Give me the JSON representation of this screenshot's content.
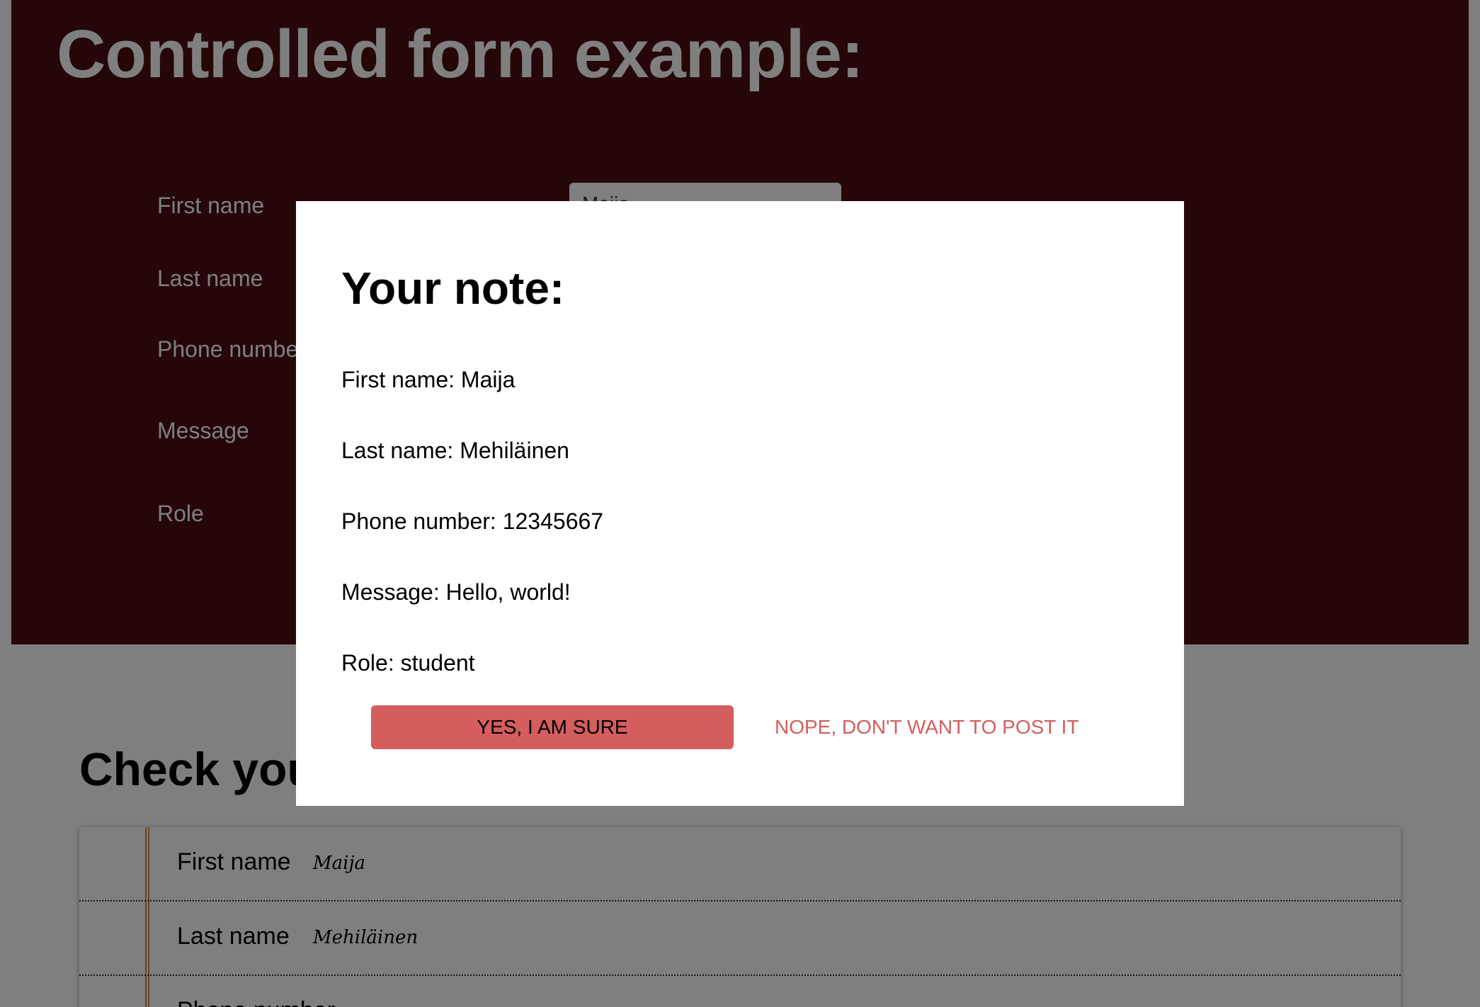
{
  "page": {
    "title": "Controlled form example:",
    "form": {
      "labels": [
        "First name",
        "Last name",
        "Phone number",
        "Message",
        "Role"
      ],
      "first_name_value": "Maija"
    },
    "check_title": "Check your note:",
    "note_card": {
      "rows": [
        {
          "label": "First name",
          "value": "Maija"
        },
        {
          "label": "Last name",
          "value": "Mehiläinen"
        },
        {
          "label": "Phone number",
          "value": ""
        }
      ]
    }
  },
  "modal": {
    "title": "Your note:",
    "lines": [
      "First name: Maija",
      "Last name: Mehiläinen",
      "Phone number: 12345667",
      "Message: Hello, world!",
      "Role: student"
    ],
    "confirm_label": "YES, I AM SURE",
    "cancel_label": "NOPE, DON'T WANT TO POST IT"
  },
  "colors": {
    "hero_background": "#4a0d12",
    "overlay": "rgba(0,0,0,0.5)",
    "accent": "#d45d5e",
    "note_margin": "#e0873a"
  }
}
